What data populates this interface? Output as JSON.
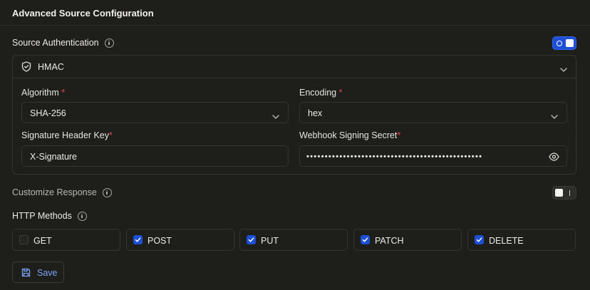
{
  "header": {
    "title": "Advanced Source Configuration"
  },
  "source_auth": {
    "label": "Source Authentication",
    "enabled": true,
    "method": {
      "label": "HMAC",
      "icon": "shield-check-icon"
    },
    "algorithm": {
      "label": "Algorithm",
      "required_mark": "*",
      "value": "SHA-256"
    },
    "encoding": {
      "label": "Encoding",
      "required_mark": "*",
      "value": "hex"
    },
    "signature_header_key": {
      "label": "Signature Header Key",
      "required_mark": "*",
      "value": "X-Signature"
    },
    "webhook_signing_secret": {
      "label": "Webhook Signing Secret",
      "required_mark": "*",
      "masked_value": "••••••••••••••••••••••••••••••••••••••••••••••••"
    }
  },
  "customize_response": {
    "label": "Customize Response",
    "enabled": false
  },
  "http_methods": {
    "label": "HTTP Methods",
    "items": [
      {
        "label": "GET",
        "checked": false
      },
      {
        "label": "POST",
        "checked": true
      },
      {
        "label": "PUT",
        "checked": true
      },
      {
        "label": "PATCH",
        "checked": true
      },
      {
        "label": "DELETE",
        "checked": true
      }
    ]
  },
  "save": {
    "label": "Save"
  },
  "colors": {
    "background": "#1e1e1b",
    "accent": "#1d4fd7",
    "required": "#e5484d",
    "save_text": "#7ea2f5"
  }
}
